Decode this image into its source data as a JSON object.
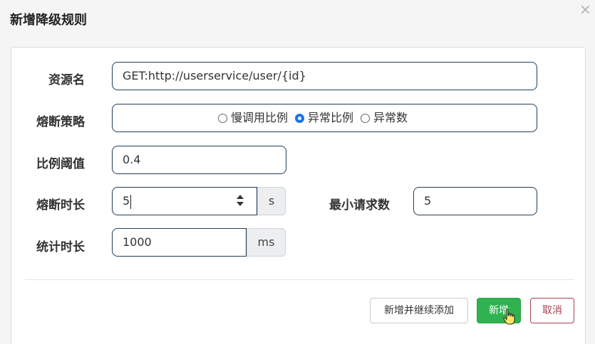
{
  "dialog": {
    "title": "新增降级规则",
    "close_icon": "close-icon"
  },
  "form": {
    "resource": {
      "label": "资源名",
      "value": "GET:http://userservice/user/{id}"
    },
    "strategy": {
      "label": "熔断策略",
      "options": [
        "慢调用比例",
        "异常比例",
        "异常数"
      ],
      "selected": "异常比例"
    },
    "ratio": {
      "label": "比例阈值",
      "value": "0.4"
    },
    "duration": {
      "label": "熔断时长",
      "value": "5",
      "unit": "s"
    },
    "min_requests": {
      "label": "最小请求数",
      "value": "5"
    },
    "stat_duration": {
      "label": "统计时长",
      "value": "1000",
      "unit": "ms"
    }
  },
  "footer": {
    "add_continue_label": "新增并继续添加",
    "add_label": "新增",
    "cancel_label": "取消"
  },
  "colors": {
    "success": "#2fb350",
    "cancel": "#a3404f",
    "input_border": "#203e5a",
    "radio_checked": "#1a73e8"
  }
}
